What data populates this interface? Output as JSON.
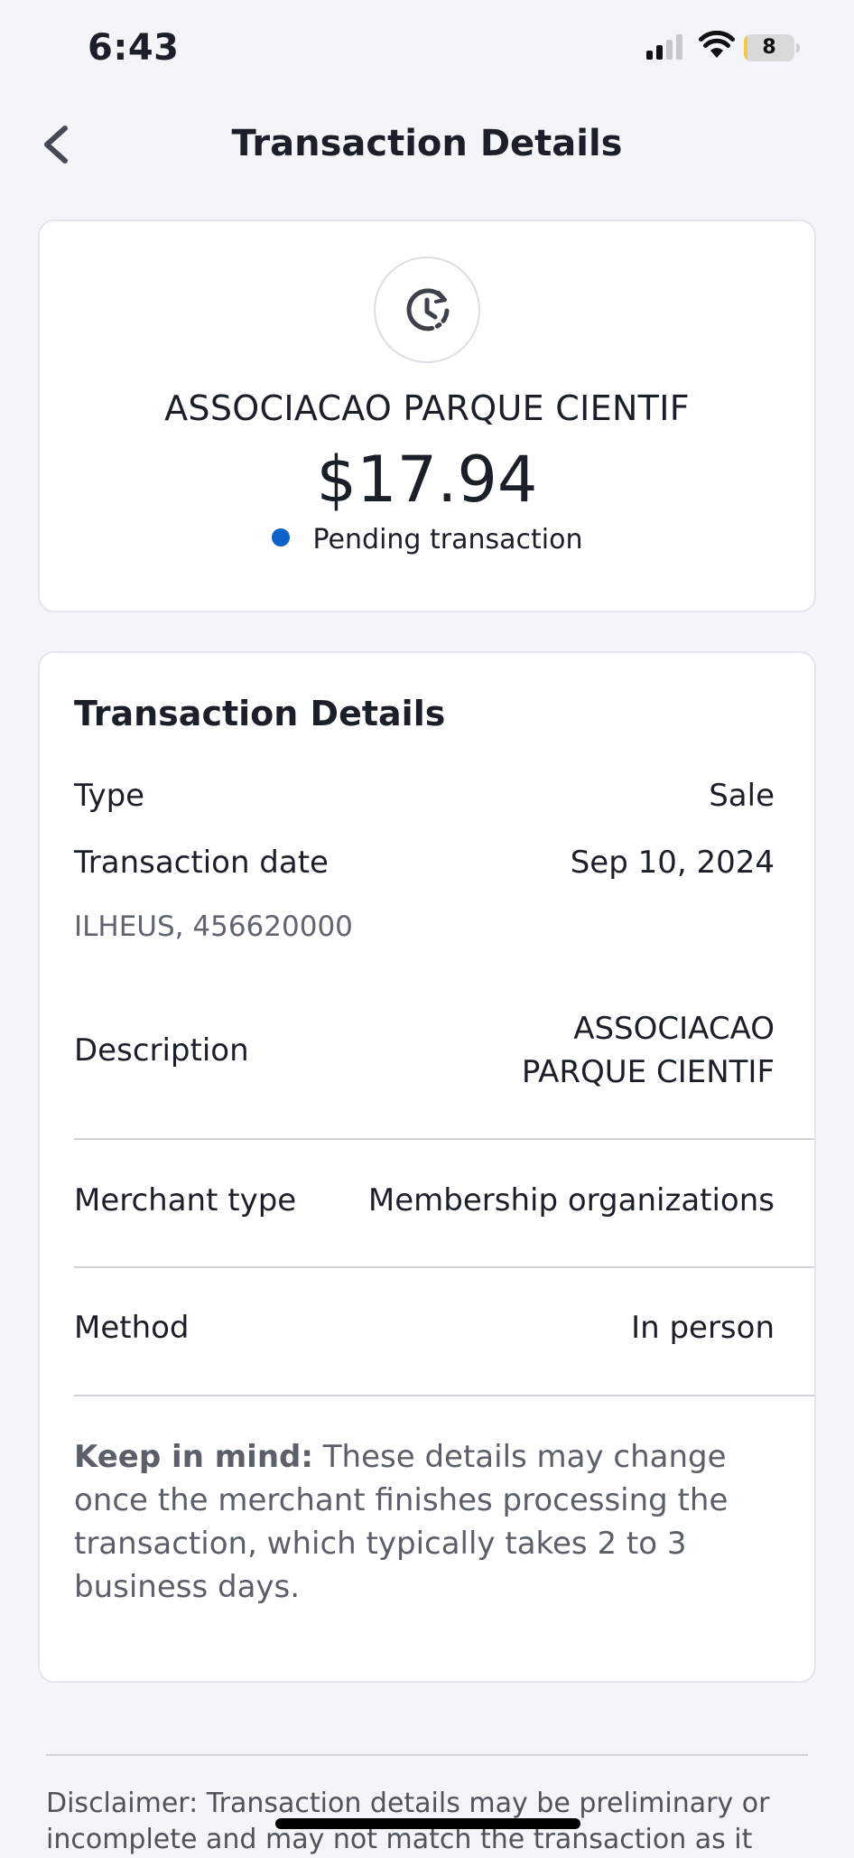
{
  "status_bar": {
    "time": "6:43",
    "battery_level": "8",
    "battery_fraction": 0.08,
    "icons": [
      "signal-icon",
      "wifi-icon",
      "battery-icon"
    ]
  },
  "nav": {
    "title": "Transaction Details",
    "back_icon": "chevron-left-icon"
  },
  "summary": {
    "icon": "pending-clock-icon",
    "merchant": "ASSOCIACAO PARQUE CIENTIF",
    "amount": "$17.94",
    "status": "Pending transaction",
    "status_color": "#0b62c9"
  },
  "details": {
    "title": "Transaction Details",
    "type_label": "Type",
    "type_value": "Sale",
    "date_label": "Transaction date",
    "date_value": "Sep 10, 2024",
    "location": "ILHEUS, 456620000",
    "description_label": "Description",
    "description_line1": "ASSOCIACAO",
    "description_line2": "PARQUE CIENTIF",
    "merchant_type_label": "Merchant type",
    "merchant_type_value": "Membership organizations",
    "method_label": "Method",
    "method_value": "In person",
    "note_bold": "Keep in mind:",
    "note_text": " These details may change once the merchant finishes processing the transaction, which typically takes 2 to 3 business days."
  },
  "disclaimer": {
    "text": "Disclaimer: Transaction details may be preliminary or incomplete and may not match the transaction as it"
  }
}
